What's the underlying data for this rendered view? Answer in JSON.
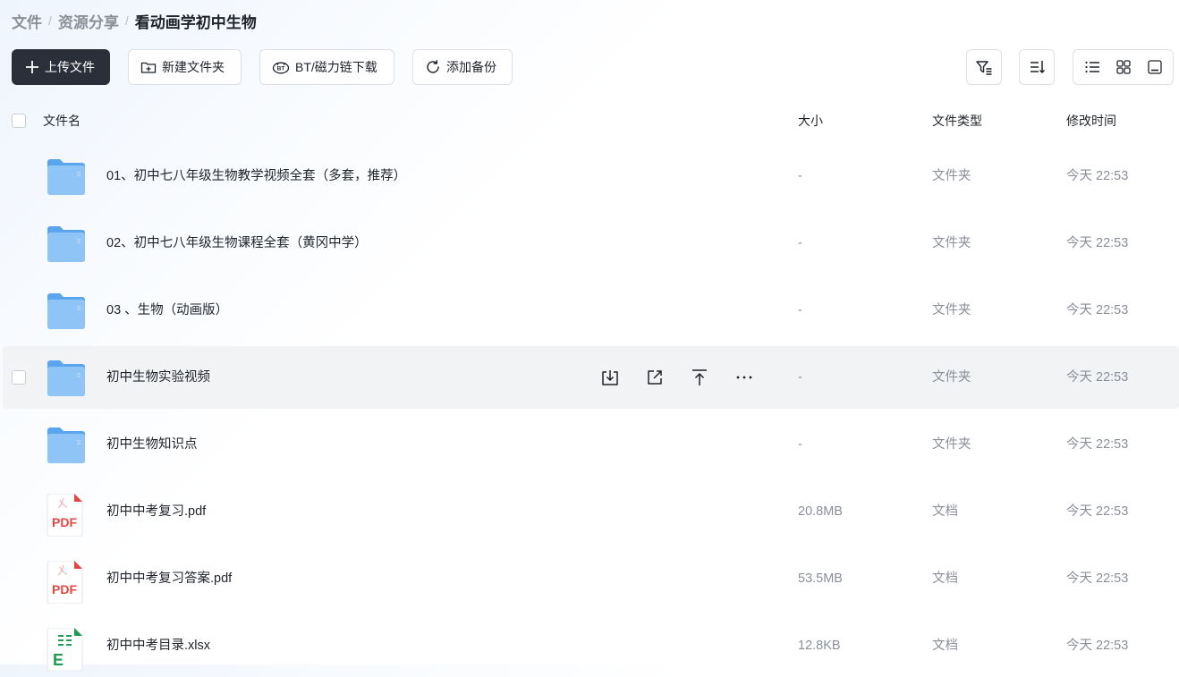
{
  "breadcrumb": {
    "items": [
      "文件",
      "资源分享",
      "看动画学初中生物"
    ],
    "separator": "/"
  },
  "toolbar": {
    "upload_label": "上传文件",
    "new_folder_label": "新建文件夹",
    "bt_label": "BT/磁力链下载",
    "backup_label": "添加备份",
    "filter_icon": "filter-icon",
    "sort_icon": "sort-icon",
    "view_modes": [
      "list-view-icon",
      "grid-view-icon",
      "preview-view-icon"
    ]
  },
  "table": {
    "columns": {
      "name": "文件名",
      "size": "大小",
      "type": "文件类型",
      "modified": "修改时间"
    },
    "rows": [
      {
        "name": "01、初中七八年级生物教学视频全套（多套，推荐）",
        "size": "-",
        "type": "文件夹",
        "modified": "今天 22:53",
        "icon": "folder-icon"
      },
      {
        "name": "02、初中七八年级生物课程全套（黄冈中学）",
        "size": "-",
        "type": "文件夹",
        "modified": "今天 22:53",
        "icon": "folder-icon"
      },
      {
        "name": "03 、生物（动画版）",
        "size": "-",
        "type": "文件夹",
        "modified": "今天 22:53",
        "icon": "folder-icon"
      },
      {
        "name": "初中生物实验视频",
        "size": "-",
        "type": "文件夹",
        "modified": "今天 22:53",
        "icon": "folder-icon",
        "hovered": true
      },
      {
        "name": "初中生物知识点",
        "size": "-",
        "type": "文件夹",
        "modified": "今天 22:53",
        "icon": "folder-icon"
      },
      {
        "name": "初中中考复习.pdf",
        "size": "20.8MB",
        "type": "文档",
        "modified": "今天 22:53",
        "icon": "pdf-icon",
        "icon_text": "PDF"
      },
      {
        "name": "初中中考复习答案.pdf",
        "size": "53.5MB",
        "type": "文档",
        "modified": "今天 22:53",
        "icon": "pdf-icon",
        "icon_text": "PDF"
      },
      {
        "name": "初中中考目录.xlsx",
        "size": "12.8KB",
        "type": "文档",
        "modified": "今天 22:53",
        "icon": "excel-icon",
        "icon_text": "E"
      }
    ],
    "row_actions": [
      "download-icon",
      "share-icon",
      "move-top-icon",
      "more-icon"
    ]
  },
  "colors": {
    "primary_button": "#2b2f3a",
    "folder": "#5aa6ee",
    "pdf": "#e5463f",
    "excel": "#1f9a55",
    "muted_text": "#8a8f99",
    "hover_row": "#f2f3f5"
  }
}
